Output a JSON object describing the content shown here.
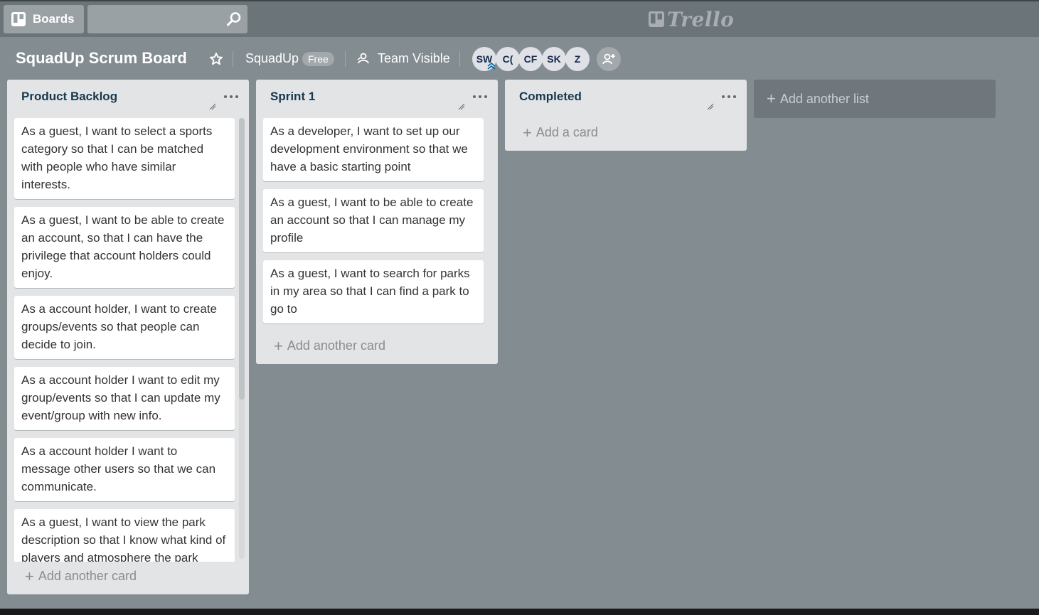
{
  "topbar": {
    "boards_label": "Boards",
    "search_placeholder": "",
    "logo_text": "Trello"
  },
  "board": {
    "title": "SquadUp Scrum Board",
    "team_name": "SquadUp",
    "team_plan": "Free",
    "visibility": "Team Visible",
    "members": [
      "SW",
      "C(",
      "CF",
      "SK",
      "Z"
    ]
  },
  "lists": [
    {
      "title": "Product Backlog",
      "cards": [
        "As a guest, I want to select a sports category so that I can be matched with people who have similar interests.",
        "As a guest, I want to be able to create an account, so that I can have the privilege that account holders could enjoy.",
        "As a account holder, I want to create groups/events so that people can decide to join.",
        "As a account holder I want to edit my group/events so that I can update my event/group with new info.",
        "As a account holder I want to message other users so that we can communicate.",
        "As a guest, I want to view the park description so that I know what kind of players and atmosphere the park"
      ],
      "add_card_label": "Add another card"
    },
    {
      "title": "Sprint 1",
      "cards": [
        "As a developer, I want to set up our development environment so that we have a basic starting point",
        "As a guest, I want to be able to create an account so that I can manage my profile",
        "As a guest, I want to search for parks in my area so that I can find a park to go to"
      ],
      "add_card_label": "Add another card"
    },
    {
      "title": "Completed",
      "cards": [],
      "add_card_label": "Add a card"
    }
  ],
  "add_list_label": "Add another list",
  "colors": {
    "board_bg": "#838c91",
    "topbar_bg": "#6b7479",
    "list_bg": "#e2e4e6",
    "card_bg": "#ffffff"
  }
}
